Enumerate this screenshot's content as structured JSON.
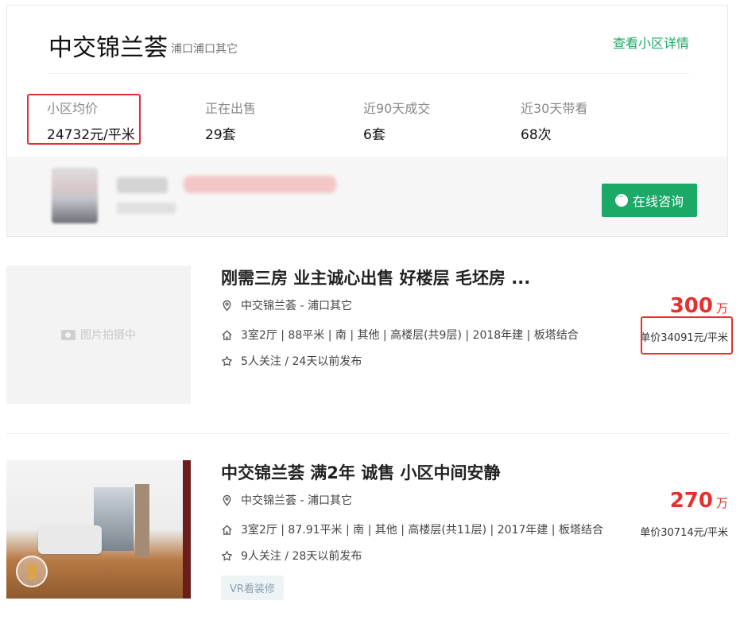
{
  "community": {
    "name": "中交锦兰荟",
    "location": "浦口浦口其它",
    "detail_link": "查看小区详情",
    "stats": [
      {
        "label": "小区均价",
        "value": "24732元/平米"
      },
      {
        "label": "正在出售",
        "value": "29套"
      },
      {
        "label": "近90天成交",
        "value": "6套"
      },
      {
        "label": "近30天带看",
        "value": "68次"
      }
    ]
  },
  "agent": {
    "consult_label": "在线咨询"
  },
  "listings": [
    {
      "title": "刚需三房 业主诚心出售 好楼层 毛坯房 ...",
      "location": "中交锦兰荟 - 浦口其它",
      "specs": "3室2厅 | 88平米 | 南 | 其他 | 高楼层(共9层) | 2018年建 | 板塔结合",
      "follow": "5人关注 / 24天以前发布",
      "price": "300",
      "price_unit": "万",
      "unit_price": "单价34091元/平米",
      "photo_placeholder": "图片拍摄中"
    },
    {
      "title": "中交锦兰荟 满2年 诚售 小区中间安静",
      "location": "中交锦兰荟 - 浦口其它",
      "specs": "3室2厅 | 87.91平米 | 南 | 其他 | 高楼层(共11层) | 2017年建 | 板塔结合",
      "follow": "9人关注 / 28天以前发布",
      "price": "270",
      "price_unit": "万",
      "unit_price": "单价30714元/平米",
      "tag": "VR看装修"
    }
  ],
  "colors": {
    "accent_green": "#1aa967",
    "price_red": "#e53030",
    "highlight_red": "#e53030"
  }
}
